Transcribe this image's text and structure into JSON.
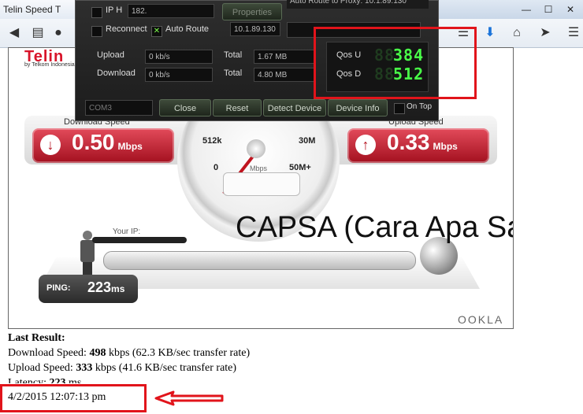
{
  "browser": {
    "tab_title": "Telin Speed T",
    "window_controls": [
      "—",
      "☐",
      "✕"
    ],
    "nav_icons": [
      "back-icon",
      "page-icon",
      "globe-icon",
      "bookmark-list-icon",
      "download-icon",
      "home-icon",
      "send-icon",
      "menu-icon"
    ]
  },
  "modem": {
    "ip_label": "IP H",
    "ip_value": "182.",
    "properties_label": "Properties",
    "auto_route_info": "Auto Route to Proxy: 10.1.89.130",
    "reconnect_label": "Reconnect",
    "auto_route_label": "Auto Route",
    "route_select": "10.1.89.130",
    "upload_label": "Upload",
    "upload_rate": "0 kb/s",
    "download_label": "Download",
    "download_rate": "0 kb/s",
    "total_label": "Total",
    "upload_total": "1.67 MB",
    "download_total": "4.80 MB",
    "qos_u_label": "Qos U",
    "qos_u_value": "384",
    "qos_d_label": "Qos D",
    "qos_d_value": "512",
    "com_select": "COM3",
    "close_label": "Close",
    "reset_label": "Reset",
    "detect_label": "Detect Device",
    "device_info_label": "Device Info",
    "ontop_label": "On Top"
  },
  "speedtest": {
    "download_label": "Download Speed",
    "download_value": "0.50",
    "upload_label": "Upload Speed",
    "upload_value": "0.33",
    "unit": "Mbps",
    "gauge_ticks": [
      "512k",
      "30M",
      "0",
      "Mbps",
      "50M+"
    ],
    "your_ip_label": "Your IP:",
    "ping_label": "PING:",
    "ping_value": "223",
    "ping_unit": "ms",
    "ookla": "OOKLA",
    "brand": "Telin",
    "brand_sub": "by Telkom Indonesia"
  },
  "overlay_caption": "CAPSA (Cara Apa Saja)",
  "results": {
    "heading": "Last Result:",
    "download_label": "Download Speed:",
    "download_value": "498",
    "download_detail": "kbps (62.3 KB/sec transfer rate)",
    "upload_label": "Upload Speed:",
    "upload_value": "333",
    "upload_detail": "kbps (41.6 KB/sec transfer rate)",
    "latency_label": "Latency:",
    "latency_value": "223",
    "latency_unit": "ms",
    "timestamp": "4/2/2015 12:07:13 pm"
  },
  "colors": {
    "annotation_red": "#e1141b",
    "speed_red": "#b5121f",
    "qos_green": "#49ff48"
  }
}
